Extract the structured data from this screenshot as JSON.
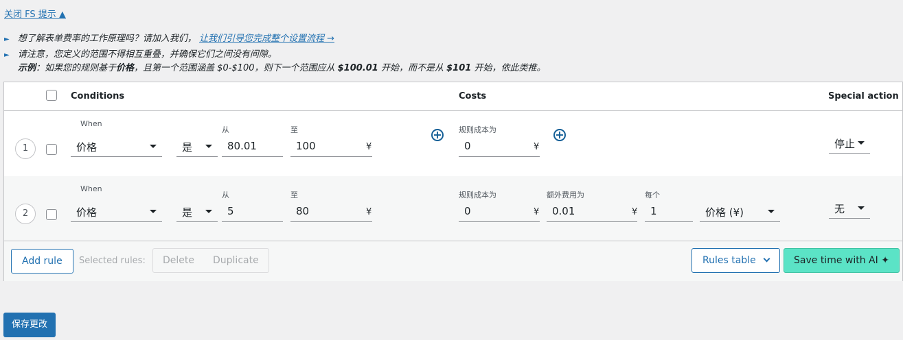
{
  "hint_toggle": "关闭 FS 提示 ▲",
  "notes": {
    "line1_text": "想了解表单费率的工作原理吗？请加入我们，",
    "line1_link": "让我们引导您完成整个设置流程 →",
    "line2": "请注意，您定义的范围不得相互重叠，并确保它们之间没有间隙。",
    "example_label": "示例",
    "example_p1": "：如果您的规则基于",
    "example_b1": "价格",
    "example_p2": "，且第一个范围涵盖 $0-$100，则下一个范围应从 ",
    "example_b2": "$100.01",
    "example_p3": " 开始，而不是从 ",
    "example_b3": "$101",
    "example_p4": " 开始，依此类推。"
  },
  "table": {
    "headers": {
      "conditions": "Conditions",
      "costs": "Costs",
      "special_action": "Special action"
    },
    "rows": [
      {
        "num": "1",
        "when_label": "When",
        "condition": "价格",
        "operator": "是",
        "from_label": "从",
        "from": "80.01",
        "to_label": "至",
        "to": "100",
        "currency": "¥",
        "cost_label": "规则成本为",
        "cost": "0",
        "action": "停止"
      },
      {
        "num": "2",
        "when_label": "When",
        "condition": "价格",
        "operator": "是",
        "from_label": "从",
        "from": "5",
        "to_label": "至",
        "to": "80",
        "currency": "¥",
        "cost_label": "规则成本为",
        "cost": "0",
        "extra_label": "额外费用为",
        "extra": "0.01",
        "per_label": "每个",
        "per": "1",
        "per_unit": "价格 (¥)",
        "action": "无"
      }
    ]
  },
  "footer": {
    "add_rule": "Add rule",
    "selected_rules": "Selected rules:",
    "delete": "Delete",
    "duplicate": "Duplicate",
    "rules_table": "Rules table",
    "ai": "Save time with AI ✦"
  },
  "save_button": "保存更改",
  "colors": {
    "accent": "#2271b1",
    "ai_button": "#5be3c6"
  }
}
